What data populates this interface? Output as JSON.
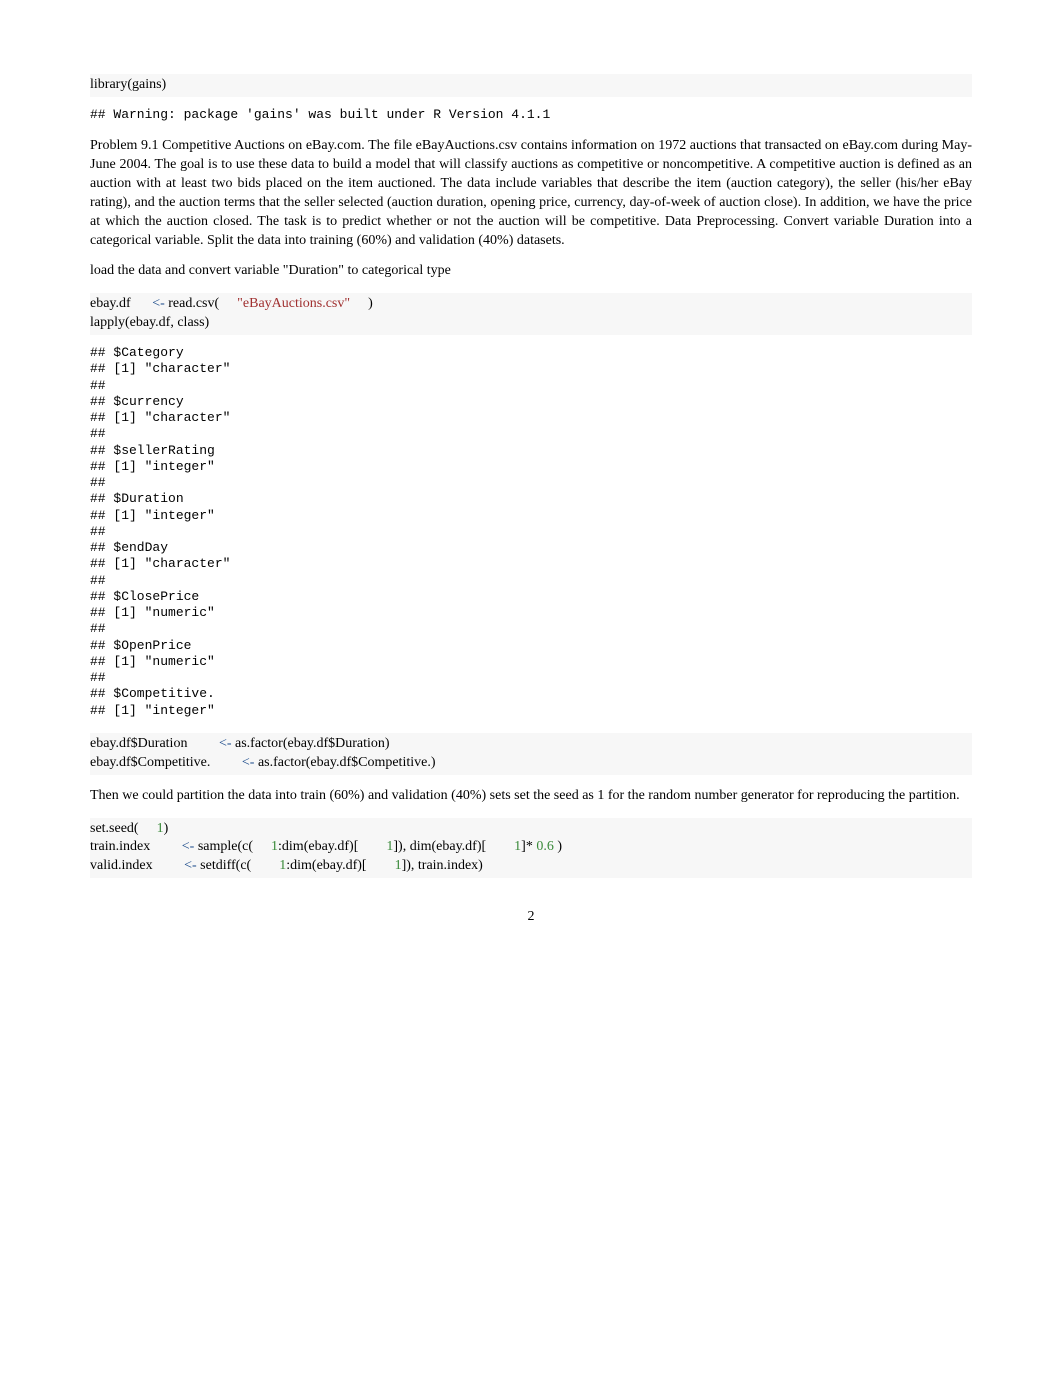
{
  "code1": {
    "text": "library(gains)"
  },
  "output1": "## Warning: package 'gains' was built under R Version 4.1.1",
  "para1": "Problem 9.1 Competitive Auctions on eBay.com. The file eBayAuctions.csv contains information on 1972 auctions that transacted on eBay.com during May-June 2004. The goal is to use these data to build a model that will classify auctions as competitive or noncompetitive. A competitive auction is defined as an auction with at least two bids placed on the item auctioned.    The data include variables that describe the item (auction category), the seller (his/her eBay rating), and the auction terms that the seller selected (auction duration, opening price, currency, day-of-week of auction close). In addition, we have the price at which the auction closed. The task is to predict whether or not the auction will be competitive. Data Preprocessing. Convert variable Duration into a categorical variable.    Split the data into training (60%) and validation (40%) datasets.",
  "para2": "load the data and convert variable \"Duration\" to categorical type",
  "code2": {
    "p1a": "ebay.df ",
    "p1b": " read.csv(",
    "p1c": "\"eBayAuctions.csv\"",
    "p1d": ")",
    "p2": "lapply(ebay.df, class)"
  },
  "output2": "## $Category\n## [1] \"character\"\n##\n## $currency\n## [1] \"character\"\n##\n## $sellerRating\n## [1] \"integer\"\n##\n## $Duration\n## [1] \"integer\"\n##\n## $endDay\n## [1] \"character\"\n##\n## $ClosePrice\n## [1] \"numeric\"\n##\n## $OpenPrice\n## [1] \"numeric\"\n##\n## $Competitive.\n## [1] \"integer\"",
  "code3": {
    "l1a": "ebay.df$Duration ",
    "l1b": " as.factor(ebay.df$Duration)",
    "l2a": "ebay.df$Competitive. ",
    "l2b": " as.factor(ebay.df$Competitive.)"
  },
  "para3": "Then we could partition the data into train (60%) and validation (40%) sets set the seed as 1 for the random number generator for reproducing the partition.",
  "code4": {
    "l1a": "set.seed(",
    "l1n": "1",
    "l1b": ")",
    "l2a": "train.index ",
    "l2b": " sample(c(",
    "l2c": ":dim(ebay.df)[",
    "l2d": "]), dim(ebay.df)[",
    "l2e": "]*",
    "l2f": " )",
    "l3a": "valid.index ",
    "l3b": " setdiff(c(",
    "l3c": ":dim(ebay.df)[",
    "l3d": "]), train.index)",
    "arrow": "<-",
    "n1": "1",
    "n06": " 0.6"
  },
  "pagenum": "2"
}
